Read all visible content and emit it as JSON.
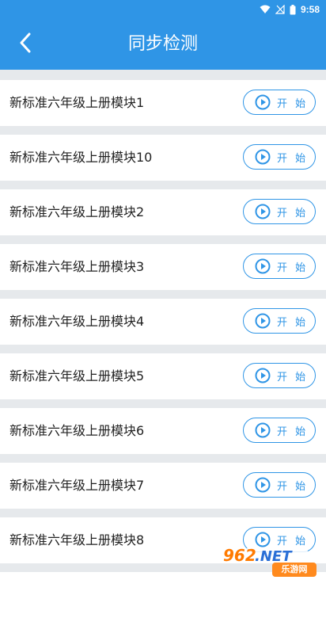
{
  "status_bar": {
    "time": "9:58"
  },
  "header": {
    "title": "同步检测",
    "back_icon": "chevron-left-icon"
  },
  "colors": {
    "primary": "#2f95e6",
    "background": "#e6e9ec",
    "text": "#222222"
  },
  "list": {
    "button_label": "开 始",
    "button_icon": "play-circle-icon",
    "items": [
      {
        "label": "新标准六年级上册模块1"
      },
      {
        "label": "新标准六年级上册模块10"
      },
      {
        "label": "新标准六年级上册模块2"
      },
      {
        "label": "新标准六年级上册模块3"
      },
      {
        "label": "新标准六年级上册模块4"
      },
      {
        "label": "新标准六年级上册模块5"
      },
      {
        "label": "新标准六年级上册模块6"
      },
      {
        "label": "新标准六年级上册模块7"
      },
      {
        "label": "新标准六年级上册模块8"
      }
    ]
  },
  "watermark": {
    "brand": "962.NET",
    "sub": "乐游网"
  }
}
